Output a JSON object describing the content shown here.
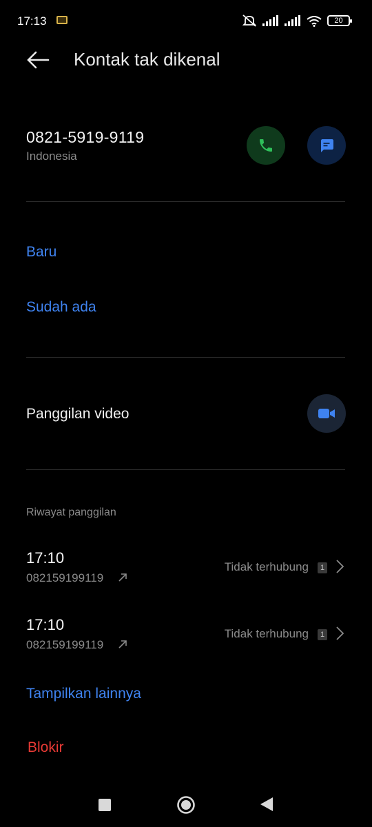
{
  "status_bar": {
    "time": "17:13",
    "battery": "20"
  },
  "header": {
    "title": "Kontak tak dikenal"
  },
  "contact": {
    "phone": "0821-5919-9119",
    "region": "Indonesia"
  },
  "add_options": {
    "new_label": "Baru",
    "existing_label": "Sudah ada"
  },
  "video": {
    "label": "Panggilan video"
  },
  "history": {
    "heading": "Riwayat panggilan",
    "entries": [
      {
        "time": "17:10",
        "number": "082159199119",
        "status": "Tidak terhubung",
        "count": "1"
      },
      {
        "time": "17:10",
        "number": "082159199119",
        "status": "Tidak terhubung",
        "count": "1"
      }
    ],
    "more_label": "Tampilkan lainnya"
  },
  "block": {
    "label": "Blokir"
  },
  "colors": {
    "accent": "#3f83f0",
    "danger": "#e83a35",
    "call_green": "#2fbf5a",
    "background": "#000000"
  },
  "icons": [
    "back-arrow-icon",
    "phone-icon",
    "message-icon",
    "video-camera-icon",
    "outgoing-arrow-icon",
    "chevron-right-icon"
  ]
}
